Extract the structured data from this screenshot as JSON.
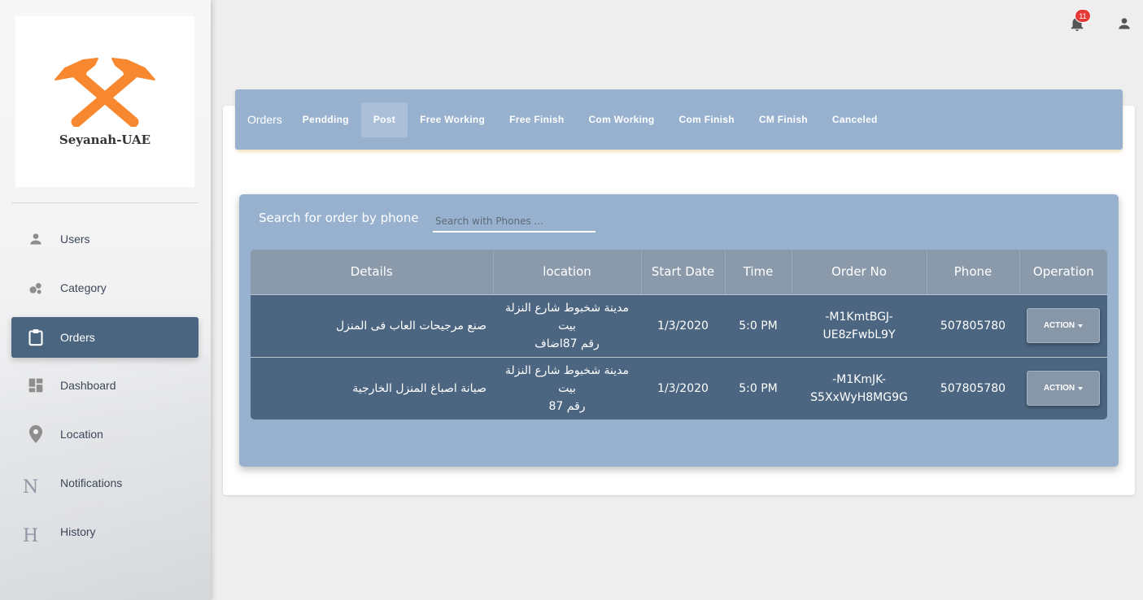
{
  "brand": {
    "name": "Seyanah-UAE",
    "accent_color": "#f7882f"
  },
  "sidebar": {
    "items": [
      {
        "label": "Users",
        "icon": "person-icon"
      },
      {
        "label": "Category",
        "icon": "bubbles-icon"
      },
      {
        "label": "Orders",
        "icon": "clipboard-icon",
        "active": true
      },
      {
        "label": "Dashboard",
        "icon": "dashboard-icon"
      },
      {
        "label": "Location",
        "icon": "location-pin-icon"
      },
      {
        "label": "Notifications",
        "icon": "letter-n-icon",
        "letter": "N"
      },
      {
        "label": "History",
        "icon": "letter-h-icon",
        "letter": "H"
      }
    ],
    "active_color": "#4a6580"
  },
  "topbar": {
    "notification_count": "11"
  },
  "tabs": {
    "title": "Orders",
    "items": [
      "Pendding",
      "Post",
      "Free Working",
      "Free Finish",
      "Com Working",
      "Com Finish",
      "CM Finish",
      "Canceled"
    ],
    "active": "Post",
    "color": "#97b1cf"
  },
  "search": {
    "label": "Search for order by phone",
    "placeholder": "Search with Phones ..."
  },
  "table": {
    "headers": [
      "Details",
      "location",
      "Start Date",
      "Time",
      "Order No",
      "Phone",
      "Operation"
    ],
    "rows": [
      {
        "details": "صنع مرجيحات العاب فى المنزل",
        "location_line1": "مدينة شخبوط شارع النزلة بيت",
        "location_line2": "رقم 87اضاف",
        "start_date": "1/3/2020",
        "time": "5:0 PM",
        "order_no_line1": "-M1KmtBGJ-",
        "order_no_line2": "UE8zFwbL9Y",
        "phone": "507805780",
        "action": "ACTION"
      },
      {
        "details": "صيانة اصباغ المنزل الخارجية",
        "location_line1": "مدينة شخبوط شارع النزلة بيت",
        "location_line2": "رقم 87",
        "start_date": "1/3/2020",
        "time": "5:0 PM",
        "order_no_line1": "-M1KmJK-",
        "order_no_line2": "S5XxWyH8MG9G",
        "phone": "507805780",
        "action": "ACTION"
      }
    ]
  }
}
